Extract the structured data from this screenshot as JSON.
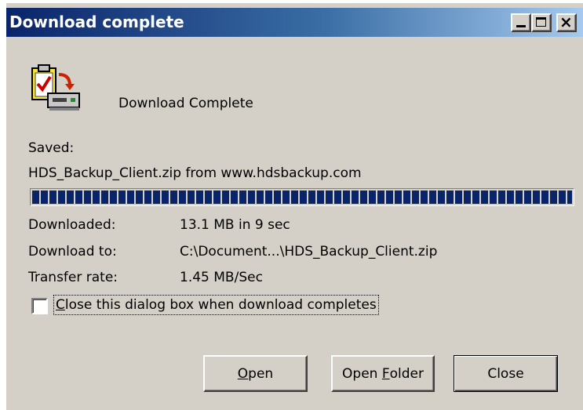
{
  "window": {
    "title": "Download complete",
    "controls": {
      "minimize": "_",
      "maximize": "□",
      "close": "×"
    }
  },
  "icon": "download-complete-icon",
  "heading": "Download Complete",
  "saved": {
    "label": "Saved:",
    "file_line": "HDS_Backup_Client.zip from www.hdsbackup.com"
  },
  "progress": {
    "percent": 100
  },
  "details": [
    {
      "label": "Downloaded:",
      "value": "13.1 MB in 9 sec"
    },
    {
      "label": "Download to:",
      "value": "C:\\Document...\\HDS_Backup_Client.zip"
    },
    {
      "label": "Transfer rate:",
      "value": "1.45 MB/Sec"
    }
  ],
  "close_when_done": {
    "checked": false,
    "label_first": "C",
    "label_rest": "lose this dialog box when download completes"
  },
  "buttons": {
    "open": {
      "mnemonic": "O",
      "rest": "pen"
    },
    "open_folder": {
      "before": "Open ",
      "mnemonic": "F",
      "rest": "older"
    },
    "close": "Close"
  },
  "colors": {
    "title_gradient_start": "#0a246a",
    "title_gradient_end": "#a6caf0",
    "progress": "#0a246a",
    "dialog_face": "#d4d0c8"
  }
}
